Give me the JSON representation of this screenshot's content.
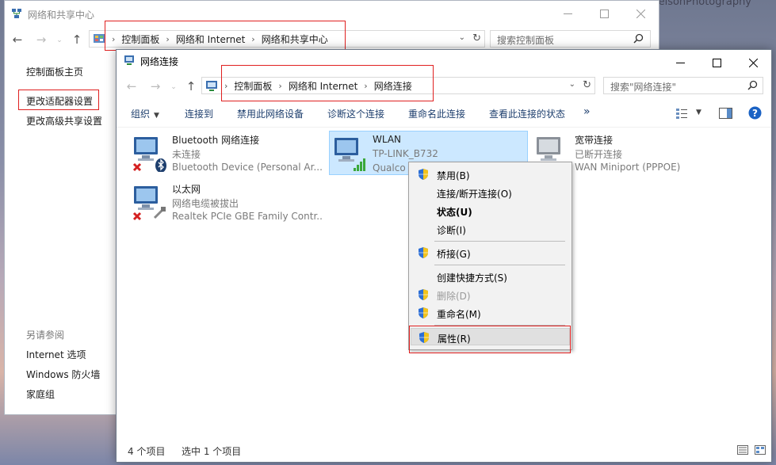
{
  "wallpaper": {
    "watermark": "rkNelsonPhotography"
  },
  "back_window": {
    "title": "网络和共享中心",
    "address": [
      "控制面板",
      "网络和 Internet",
      "网络和共享中心"
    ],
    "search_placeholder": "搜索控制面板",
    "left_links": {
      "home": "控制面板主页",
      "adapter": "更改适配器设置",
      "sharing": "更改高级共享设置",
      "see_also": "另请参阅",
      "internet_options": "Internet 选项",
      "firewall": "Windows 防火墙",
      "homegroup": "家庭组"
    }
  },
  "front_window": {
    "title": "网络连接",
    "address": [
      "控制面板",
      "网络和 Internet",
      "网络连接"
    ],
    "search_placeholder": "搜索\"网络连接\"",
    "toolbar": {
      "organize": "组织",
      "connect": "连接到",
      "disable": "禁用此网络设备",
      "diagnose": "诊断这个连接",
      "rename": "重命名此连接",
      "view_status": "查看此连接的状态",
      "more": "»"
    },
    "connections": [
      {
        "name": "Bluetooth 网络连接",
        "status": "未连接",
        "device": "Bluetooth Device (Personal Ar..."
      },
      {
        "name": "WLAN",
        "status": "TP-LINK_B732",
        "device": "Qualco"
      },
      {
        "name": "宽带连接",
        "status": "已断开连接",
        "device": "WAN Miniport (PPPOE)"
      },
      {
        "name": "以太网",
        "status": "网络电缆被拔出",
        "device": "Realtek PCIe GBE Family Contr..."
      }
    ],
    "status_bar": {
      "count": "4 个项目",
      "selected": "选中 1 个项目"
    }
  },
  "context_menu": {
    "items": [
      {
        "label": "禁用(B)",
        "shield": true
      },
      {
        "label": "连接/断开连接(O)",
        "shield": false
      },
      {
        "label": "状态(U)",
        "shield": false,
        "bold": true
      },
      {
        "label": "诊断(I)",
        "shield": false
      },
      {
        "label": "桥接(G)",
        "shield": true
      },
      {
        "label": "创建快捷方式(S)",
        "shield": false
      },
      {
        "label": "删除(D)",
        "shield": true,
        "disabled": true
      },
      {
        "label": "重命名(M)",
        "shield": true
      },
      {
        "label": "属性(R)",
        "shield": true,
        "highlighted": true
      }
    ]
  },
  "colors": {
    "highlight_border": "#e02020",
    "selection_bg": "#cce8ff",
    "link": "#1e3f6e"
  }
}
